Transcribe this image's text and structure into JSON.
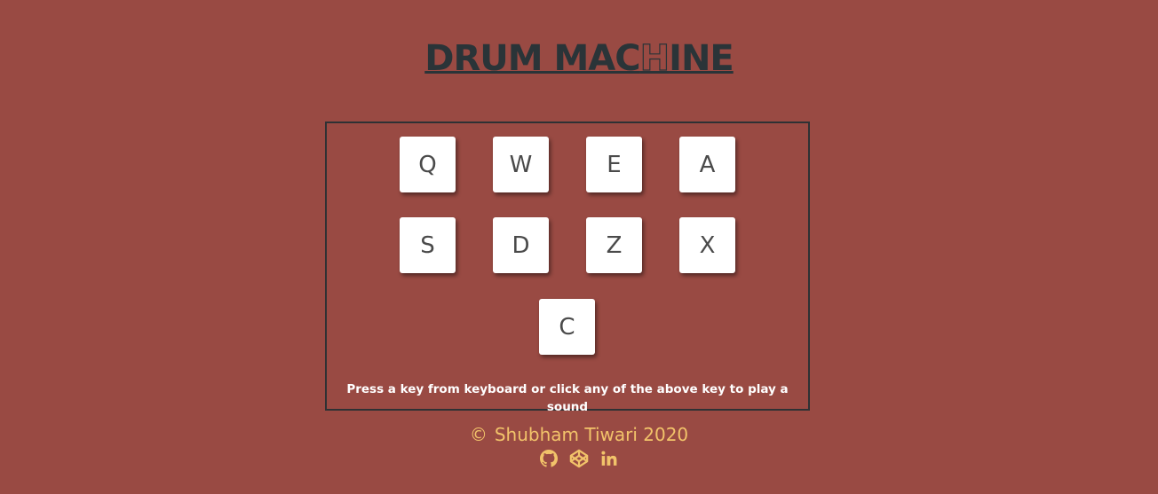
{
  "title": {
    "part1": "DRUM MAC",
    "part2": "H",
    "part3": "INE"
  },
  "pads": [
    {
      "key": "Q"
    },
    {
      "key": "W"
    },
    {
      "key": "E"
    },
    {
      "key": "A"
    },
    {
      "key": "S"
    },
    {
      "key": "D"
    },
    {
      "key": "Z"
    },
    {
      "key": "X"
    },
    {
      "key": "C"
    }
  ],
  "display": {
    "text": "Press a key from keyboard or click any of the above key to play a sound"
  },
  "footer": {
    "copyright_symbol": "©",
    "author": "Shubham Tiwari 2020",
    "links": [
      {
        "icon": "github-icon"
      },
      {
        "icon": "codepen-icon"
      },
      {
        "icon": "linkedin-icon"
      }
    ]
  },
  "colors": {
    "background": "#994a43",
    "title": "#2a3438",
    "pad": "#ffffff",
    "pad_text": "#4a4a4a",
    "footer": "#f2c36a"
  }
}
